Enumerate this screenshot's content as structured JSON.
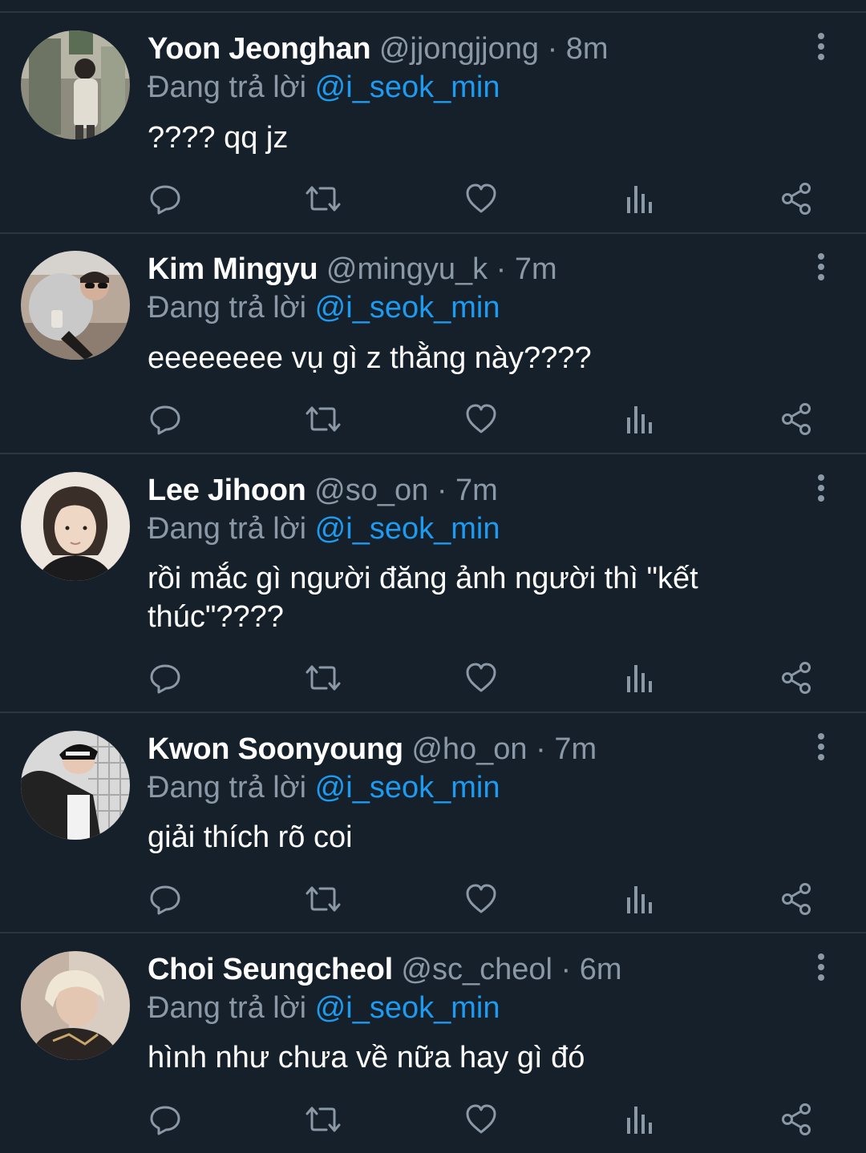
{
  "colors": {
    "background": "#15202b",
    "divider": "#2b3640",
    "muted": "#8b98a5",
    "mention": "#1d9bf0",
    "icon": "#8b98a5"
  },
  "icons": {
    "reply": "reply-icon",
    "retweet": "retweet-icon",
    "like": "like-icon",
    "views": "views-icon",
    "share": "share-icon",
    "more": "more-vertical-icon"
  },
  "tweets": [
    {
      "name": "Yoon Jeonghan",
      "handle": "@jjongjjong",
      "time": "· 8m",
      "reply_prefix": "Đang trả lời",
      "reply_to": "@i_seok_min",
      "text": "???? qq jz"
    },
    {
      "name": "Kim Mingyu",
      "handle": "@mingyu_k",
      "time": "· 7m",
      "reply_prefix": "Đang trả lời",
      "reply_to": "@i_seok_min",
      "text": "eeeeeeee vụ gì z thằng này????"
    },
    {
      "name": "Lee Jihoon",
      "handle": "@so_on",
      "time": "· 7m",
      "reply_prefix": "Đang trả lời",
      "reply_to": "@i_seok_min",
      "text": "rồi mắc gì người đăng ảnh người thì \"kết thúc\"????"
    },
    {
      "name": "Kwon Soonyoung",
      "handle": "@ho_on",
      "time": "· 7m",
      "reply_prefix": "Đang trả lời",
      "reply_to": "@i_seok_min",
      "text": "giải thích rõ coi"
    },
    {
      "name": "Choi Seungcheol",
      "handle": "@sc_cheol",
      "time": "· 6m",
      "reply_prefix": "Đang trả lời",
      "reply_to": "@i_seok_min",
      "text": "hình như chưa về nữa hay gì đó"
    }
  ]
}
